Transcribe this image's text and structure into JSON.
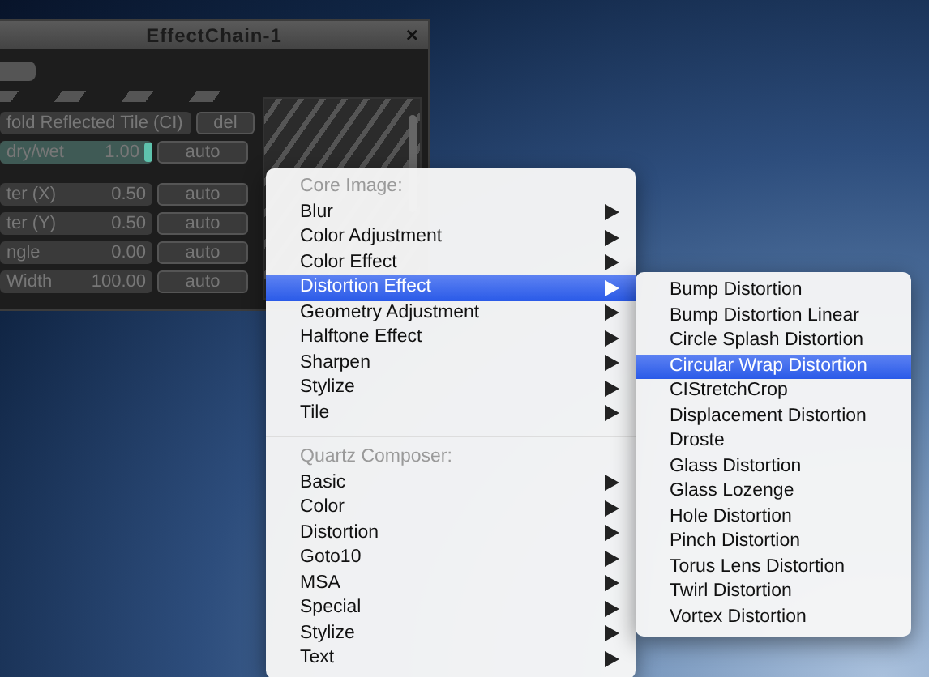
{
  "window": {
    "title": "EffectChain-1",
    "close": "×",
    "effect": {
      "name": "fold Reflected Tile (CI)",
      "delete": "del"
    },
    "params": [
      {
        "kind": "slider",
        "label": "dry/wet",
        "value": "1.00",
        "level": 1,
        "auto": "auto"
      },
      {
        "kind": "number",
        "label": "ter (X)",
        "value": "0.50",
        "auto": "auto"
      },
      {
        "kind": "number",
        "label": "ter (Y)",
        "value": "0.50",
        "auto": "auto"
      },
      {
        "kind": "number",
        "label": "ngle",
        "value": "0.00",
        "auto": "auto"
      },
      {
        "kind": "number",
        "label": "Width",
        "value": "100.00",
        "auto": "auto"
      }
    ]
  },
  "menu": {
    "sections": [
      {
        "header": "Core Image:",
        "items": [
          {
            "label": "Blur",
            "submenu": true,
            "selected": false
          },
          {
            "label": "Color Adjustment",
            "submenu": true,
            "selected": false
          },
          {
            "label": "Color Effect",
            "submenu": true,
            "selected": false
          },
          {
            "label": "Distortion Effect",
            "submenu": true,
            "selected": true
          },
          {
            "label": "Geometry Adjustment",
            "submenu": true,
            "selected": false
          },
          {
            "label": "Halftone Effect",
            "submenu": true,
            "selected": false
          },
          {
            "label": "Sharpen",
            "submenu": true,
            "selected": false
          },
          {
            "label": "Stylize",
            "submenu": true,
            "selected": false
          },
          {
            "label": "Tile",
            "submenu": true,
            "selected": false
          }
        ]
      },
      {
        "header": "Quartz Composer:",
        "items": [
          {
            "label": "Basic",
            "submenu": true,
            "selected": false
          },
          {
            "label": "Color",
            "submenu": true,
            "selected": false
          },
          {
            "label": "Distortion",
            "submenu": true,
            "selected": false
          },
          {
            "label": "Goto10",
            "submenu": true,
            "selected": false
          },
          {
            "label": "MSA",
            "submenu": true,
            "selected": false
          },
          {
            "label": "Special",
            "submenu": true,
            "selected": false
          },
          {
            "label": "Stylize",
            "submenu": true,
            "selected": false
          },
          {
            "label": "Text",
            "submenu": true,
            "selected": false
          }
        ]
      }
    ]
  },
  "submenu": {
    "items": [
      {
        "label": "Bump Distortion",
        "selected": false
      },
      {
        "label": "Bump Distortion Linear",
        "selected": false
      },
      {
        "label": "Circle Splash Distortion",
        "selected": false
      },
      {
        "label": "Circular Wrap Distortion",
        "selected": true
      },
      {
        "label": "CIStretchCrop",
        "selected": false
      },
      {
        "label": "Displacement Distortion",
        "selected": false
      },
      {
        "label": "Droste",
        "selected": false
      },
      {
        "label": "Glass Distortion",
        "selected": false
      },
      {
        "label": "Glass Lozenge",
        "selected": false
      },
      {
        "label": "Hole Distortion",
        "selected": false
      },
      {
        "label": "Pinch Distortion",
        "selected": false
      },
      {
        "label": "Torus Lens Distortion",
        "selected": false
      },
      {
        "label": "Twirl Distortion",
        "selected": false
      },
      {
        "label": "Vortex Distortion",
        "selected": false
      }
    ]
  }
}
